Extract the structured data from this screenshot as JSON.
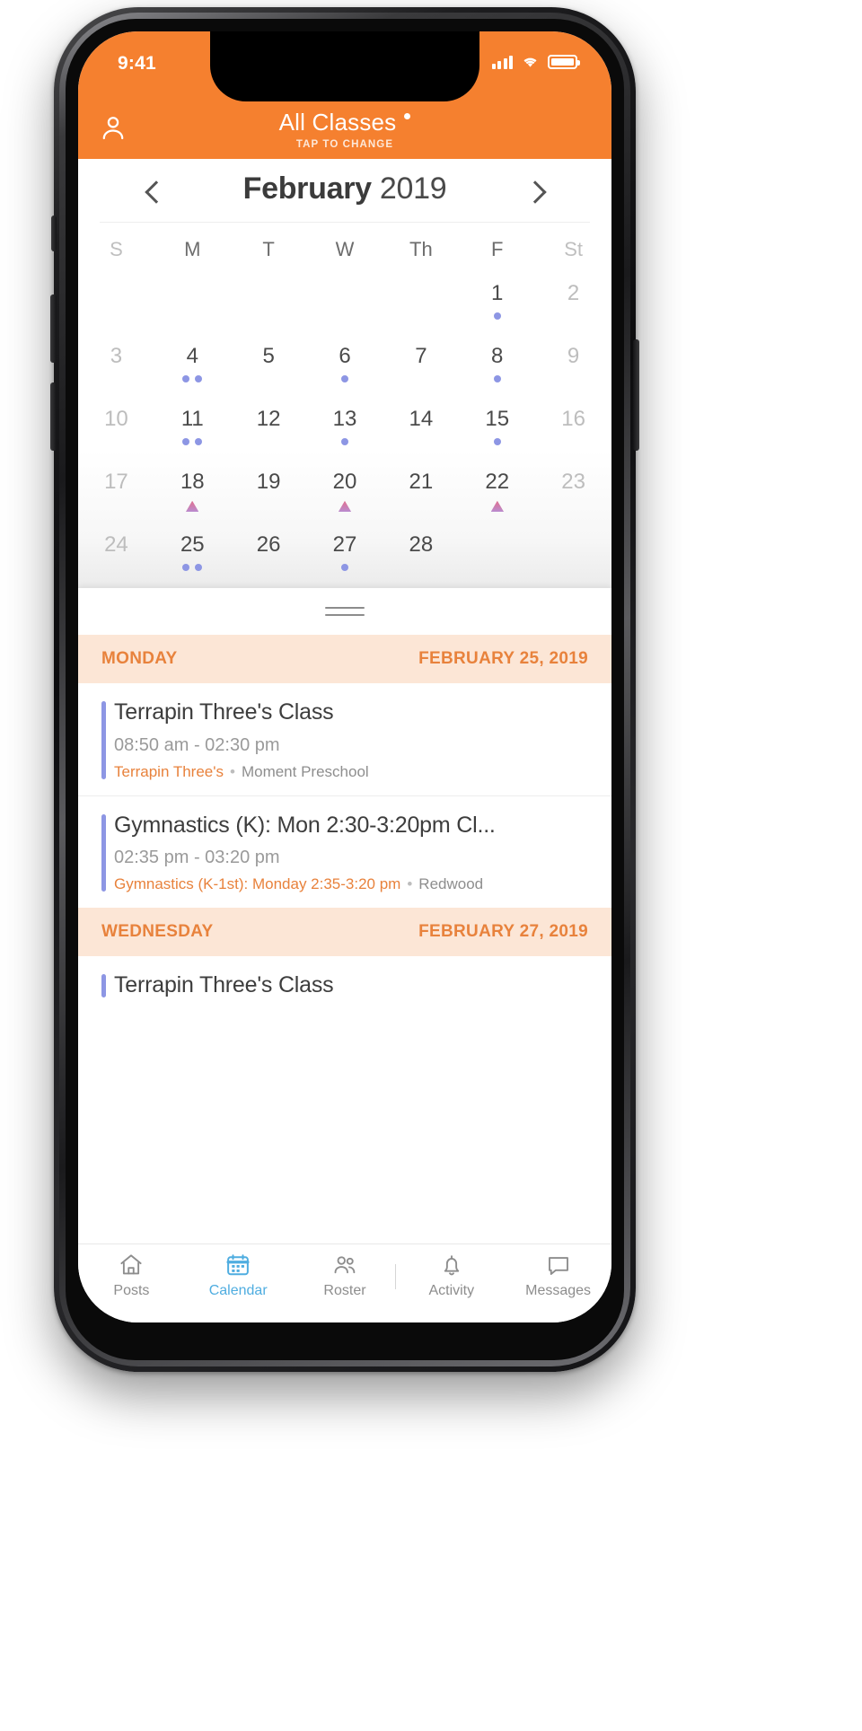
{
  "status_bar": {
    "time": "9:41",
    "signal_icon": "cellular-signal-icon",
    "wifi_icon": "wifi-icon",
    "battery_icon": "battery-icon"
  },
  "nav": {
    "profile_icon": "profile-icon",
    "title": "All Classes",
    "subtitle": "TAP TO CHANGE",
    "indicator_dot": true
  },
  "month_header": {
    "prev_icon": "chevron-left-icon",
    "next_icon": "chevron-right-icon",
    "month": "February",
    "year": "2019"
  },
  "calendar": {
    "weekdays": [
      {
        "label": "S",
        "weekend": true
      },
      {
        "label": "M",
        "weekend": false
      },
      {
        "label": "T",
        "weekend": false
      },
      {
        "label": "W",
        "weekend": false
      },
      {
        "label": "Th",
        "weekend": false
      },
      {
        "label": "F",
        "weekend": false
      },
      {
        "label": "St",
        "weekend": true
      }
    ],
    "weeks": [
      [
        {
          "day": ""
        },
        {
          "day": ""
        },
        {
          "day": ""
        },
        {
          "day": ""
        },
        {
          "day": ""
        },
        {
          "day": "1",
          "markers": [
            "dot"
          ]
        },
        {
          "day": "2",
          "weekend": true
        }
      ],
      [
        {
          "day": "3",
          "weekend": true
        },
        {
          "day": "4",
          "markers": [
            "dot",
            "dot"
          ]
        },
        {
          "day": "5"
        },
        {
          "day": "6",
          "markers": [
            "dot"
          ]
        },
        {
          "day": "7"
        },
        {
          "day": "8",
          "markers": [
            "dot"
          ]
        },
        {
          "day": "9",
          "weekend": true
        }
      ],
      [
        {
          "day": "10",
          "weekend": true
        },
        {
          "day": "11",
          "markers": [
            "dot",
            "dot"
          ]
        },
        {
          "day": "12"
        },
        {
          "day": "13",
          "markers": [
            "dot"
          ]
        },
        {
          "day": "14"
        },
        {
          "day": "15",
          "markers": [
            "dot"
          ]
        },
        {
          "day": "16",
          "weekend": true
        }
      ],
      [
        {
          "day": "17",
          "weekend": true
        },
        {
          "day": "18",
          "markers": [
            "triangle"
          ]
        },
        {
          "day": "19"
        },
        {
          "day": "20",
          "markers": [
            "triangle"
          ]
        },
        {
          "day": "21"
        },
        {
          "day": "22",
          "markers": [
            "triangle"
          ]
        },
        {
          "day": "23",
          "weekend": true
        }
      ],
      [
        {
          "day": "24",
          "weekend": true
        },
        {
          "day": "25",
          "markers": [
            "dot",
            "dot"
          ]
        },
        {
          "day": "26"
        },
        {
          "day": "27",
          "markers": [
            "dot"
          ]
        },
        {
          "day": "28"
        },
        {
          "day": ""
        },
        {
          "day": ""
        }
      ]
    ]
  },
  "agenda": {
    "grabber_icon": "drag-handle-icon",
    "sections": [
      {
        "weekday": "MONDAY",
        "date": "FEBRUARY 25, 2019",
        "events": [
          {
            "title": "Terrapin Three's Class",
            "time": "08:50 am - 02:30 pm",
            "class_name": "Terrapin Three's",
            "location": "Moment Preschool"
          },
          {
            "title": "Gymnastics (K): Mon 2:30-3:20pm Cl...",
            "time": "02:35 pm - 03:20 pm",
            "class_name": "Gymnastics (K-1st): Monday 2:35-3:20 pm",
            "location": "Redwood"
          }
        ]
      },
      {
        "weekday": "WEDNESDAY",
        "date": "FEBRUARY 27, 2019",
        "events": [
          {
            "title": "Terrapin Three's Class",
            "time": "",
            "class_name": "",
            "location": ""
          }
        ]
      }
    ]
  },
  "tabbar": {
    "items": [
      {
        "label": "Posts",
        "icon": "home-icon",
        "active": false
      },
      {
        "label": "Calendar",
        "icon": "calendar-icon",
        "active": true
      },
      {
        "label": "Roster",
        "icon": "people-icon",
        "active": false
      },
      {
        "label": "Activity",
        "icon": "bell-icon",
        "active": false
      },
      {
        "label": "Messages",
        "icon": "message-icon",
        "active": false
      }
    ]
  },
  "colors": {
    "brand_orange": "#F5802F",
    "section_header_bg": "#FCE6D6",
    "section_header_text": "#E8823C",
    "event_bar": "#8D96E4",
    "marker_dot": "#8D96E4",
    "active_tab": "#4FADE0"
  }
}
